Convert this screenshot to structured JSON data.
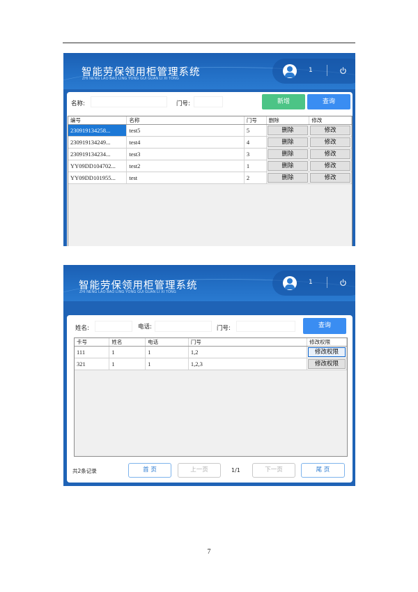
{
  "app": {
    "title": "智能劳保领用柜管理系统",
    "subtitle": "ZHI NENG LAO BAO LING YONG GUI GUAN LI XI TONG",
    "user": "1"
  },
  "screen1": {
    "search": {
      "name_label": "名称:",
      "door_label": "门号:",
      "add_label": "新增",
      "query_label": "查询"
    },
    "columns": [
      "编号",
      "名称",
      "门号",
      "删除",
      "修改"
    ],
    "rows": [
      {
        "id": "230919134258...",
        "name": "test5",
        "door": "5",
        "delete": "删除",
        "edit": "修改"
      },
      {
        "id": "230919134249...",
        "name": "test4",
        "door": "4",
        "delete": "删除",
        "edit": "修改"
      },
      {
        "id": "230919134234...",
        "name": "test3",
        "door": "3",
        "delete": "删除",
        "edit": "修改"
      },
      {
        "id": "YY09DD104702...",
        "name": "test2",
        "door": "1",
        "delete": "删除",
        "edit": "修改"
      },
      {
        "id": "YY09DD101955...",
        "name": "test",
        "door": "2",
        "delete": "删除",
        "edit": "修改"
      }
    ]
  },
  "screen2": {
    "search": {
      "name_label": "姓名:",
      "phone_label": "电话:",
      "door_label": "门号:",
      "query_label": "查询"
    },
    "columns": [
      "卡号",
      "姓名",
      "电话",
      "门号",
      "修改权限"
    ],
    "rows": [
      {
        "card": "111",
        "name": "1",
        "phone": "1",
        "doors": "1,2",
        "action": "修改权限"
      },
      {
        "card": "321",
        "name": "1",
        "phone": "1",
        "doors": "1,2,3",
        "action": "修改权限"
      }
    ],
    "pagination": {
      "record_count": "共2条记录",
      "first": "首 页",
      "prev": "上一页",
      "page": "1/1",
      "next": "下一页",
      "last": "尾 页"
    }
  },
  "page_number": "7",
  "colors": {
    "header_blue": "#1f63b6",
    "button_blue": "#3a8df2",
    "button_green": "#4cc486",
    "selection_blue": "#1c78d6"
  },
  "icons": [
    "user-avatar-icon",
    "power-icon"
  ]
}
